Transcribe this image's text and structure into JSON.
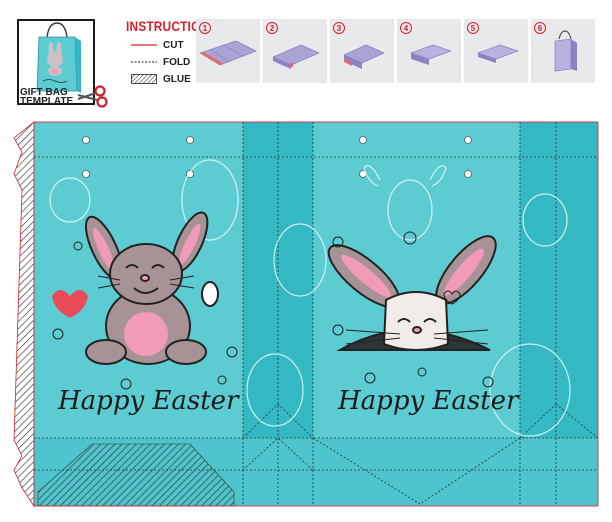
{
  "thumbnail": {
    "label_line1": "GIFT BAG",
    "label_line2": "TEMPLATE",
    "icon": "scissors-icon"
  },
  "legend": {
    "title": "INSTRUCTION",
    "items": [
      {
        "label": "CUT",
        "type": "cut"
      },
      {
        "label": "FOLD",
        "type": "fold"
      },
      {
        "label": "GLUE",
        "type": "glue"
      }
    ]
  },
  "steps": [
    "1",
    "2",
    "3",
    "4",
    "5",
    "6"
  ],
  "panels": {
    "left_text": "Happy Easter",
    "right_text": "Happy Easter"
  },
  "colors": {
    "panel": "#5ccbd2",
    "panel_dark": "#34b8c3",
    "cut": "#d4202a",
    "step_shape": "#a9a3d6"
  }
}
